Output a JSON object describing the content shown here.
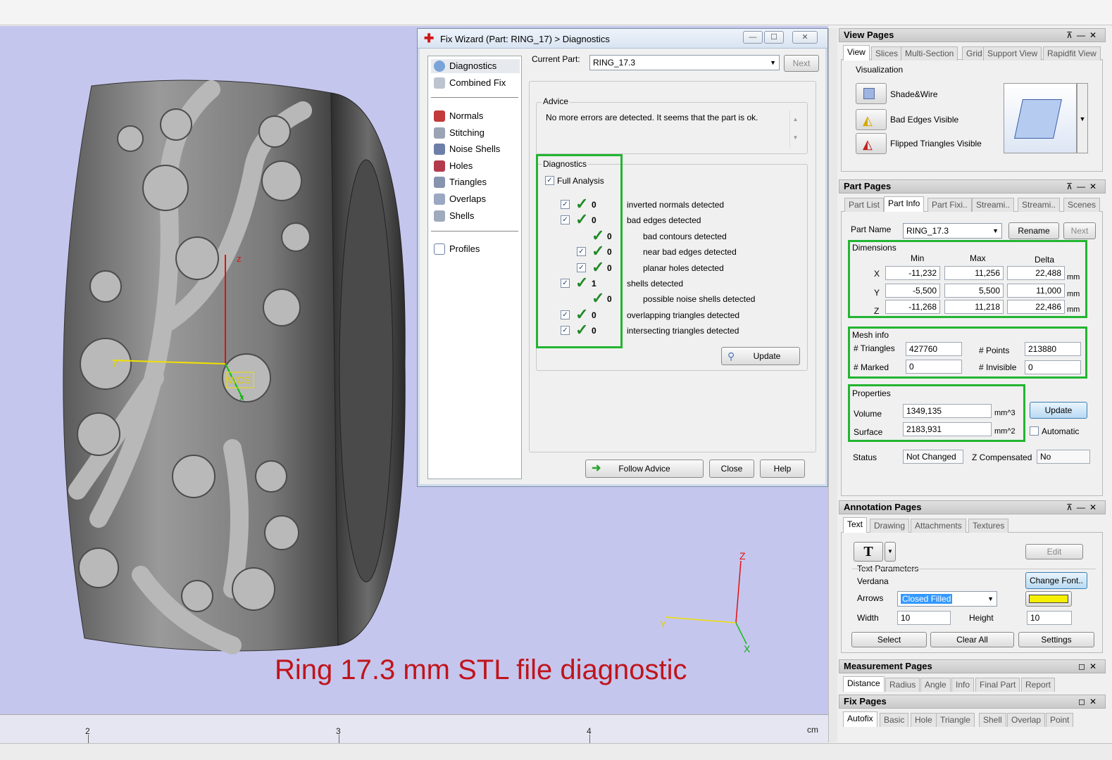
{
  "viewport": {
    "caption": "Ring 17.3 mm STL file diagnostic",
    "axes": {
      "z": "Z",
      "y": "Y",
      "x": "X",
      "wcs": "WCS",
      "small_z": "z",
      "small_y": "y",
      "small_x": "x"
    },
    "ruler": {
      "ticks": [
        "2",
        "3",
        "4"
      ],
      "unit": "cm"
    }
  },
  "fix_wizard": {
    "title": "Fix Wizard (Part: RING_17) > Diagnostics",
    "nav": {
      "top": [
        "Diagnostics",
        "Combined Fix"
      ],
      "middle": [
        "Normals",
        "Stitching",
        "Noise Shells",
        "Holes",
        "Triangles",
        "Overlaps",
        "Shells"
      ],
      "bottom": [
        "Profiles"
      ]
    },
    "current_part_label": "Current Part:",
    "current_part_value": "RING_17.3",
    "next_label": "Next",
    "advice_label": "Advice",
    "advice_text": "No more errors are detected. It seems that the part is ok.",
    "diagnostics_label": "Diagnostics",
    "full_analysis_label": "Full Analysis",
    "rows": [
      {
        "count": "0",
        "text": "inverted normals detected",
        "checkbox": true
      },
      {
        "count": "0",
        "text": "bad edges detected",
        "checkbox": true
      },
      {
        "count": "0",
        "text": "bad contours detected",
        "checkbox": false
      },
      {
        "count": "0",
        "text": "near bad edges detected",
        "checkbox": true
      },
      {
        "count": "0",
        "text": "planar holes detected",
        "checkbox": true
      },
      {
        "count": "1",
        "text": "shells detected",
        "checkbox": true
      },
      {
        "count": "0",
        "text": "possible noise shells detected",
        "checkbox": false
      },
      {
        "count": "0",
        "text": "overlapping triangles detected",
        "checkbox": true
      },
      {
        "count": "0",
        "text": "intersecting triangles detected",
        "checkbox": true
      }
    ],
    "update_label": "Update",
    "follow_advice_label": "Follow Advice",
    "close_label": "Close",
    "help_label": "Help"
  },
  "view_pages": {
    "title": "View Pages",
    "tabs": [
      "View",
      "Slices",
      "Multi-Section",
      "Grid",
      "Support View",
      "Rapidfit View"
    ],
    "visualization_label": "Visualization",
    "options": [
      "Shade&Wire",
      "Bad Edges Visible",
      "Flipped Triangles Visible"
    ]
  },
  "part_pages": {
    "title": "Part Pages",
    "tabs": [
      "Part List",
      "Part Info",
      "Part Fixi..",
      "Streami..",
      "Streami..",
      "Scenes"
    ],
    "part_name_label": "Part Name",
    "part_name_value": "RING_17.3",
    "rename_label": "Rename",
    "next_label": "Next",
    "dimensions_label": "Dimensions",
    "dim_headers": [
      "Min",
      "Max",
      "Delta"
    ],
    "dims": [
      {
        "axis": "X",
        "min": "-11,232",
        "max": "11,256",
        "delta": "22,488",
        "unit": "mm"
      },
      {
        "axis": "Y",
        "min": "-5,500",
        "max": "5,500",
        "delta": "11,000",
        "unit": "mm"
      },
      {
        "axis": "Z",
        "min": "-11,268",
        "max": "11,218",
        "delta": "22,486",
        "unit": "mm"
      }
    ],
    "mesh_info_label": "Mesh info",
    "triangles_label": "# Triangles",
    "triangles_value": "427760",
    "points_label": "# Points",
    "points_value": "213880",
    "marked_label": "# Marked",
    "marked_value": "0",
    "invisible_label": "# Invisible",
    "invisible_value": "0",
    "properties_label": "Properties",
    "volume_label": "Volume",
    "volume_value": "1349,135",
    "volume_unit": "mm^3",
    "surface_label": "Surface",
    "surface_value": "2183,931",
    "surface_unit": "mm^2",
    "update_label": "Update",
    "automatic_label": "Automatic",
    "status_label": "Status",
    "status_value": "Not Changed",
    "zcomp_label": "Z Compensated",
    "zcomp_value": "No"
  },
  "annotation_pages": {
    "title": "Annotation Pages",
    "tabs": [
      "Text",
      "Drawing",
      "Attachments",
      "Textures"
    ],
    "text_tool": "T",
    "edit_label": "Edit",
    "text_params_label": "Text Parameters",
    "font_name": "Verdana",
    "change_font_label": "Change Font..",
    "arrows_label": "Arrows",
    "arrows_value": "Closed Filled",
    "width_label": "Width",
    "width_value": "10",
    "height_label": "Height",
    "height_value": "10",
    "select_label": "Select",
    "clear_all_label": "Clear All",
    "settings_label": "Settings",
    "color": "#f5ef00"
  },
  "measurement_pages": {
    "title": "Measurement Pages",
    "tabs": [
      "Distance",
      "Radius",
      "Angle",
      "Info",
      "Final Part",
      "Report"
    ]
  },
  "fix_pages": {
    "title": "Fix Pages",
    "tabs": [
      "Autofix",
      "Basic",
      "Hole",
      "Triangle",
      "Shell",
      "Overlap",
      "Point"
    ]
  },
  "colors": {
    "highlight_green": "#22b531",
    "caption_red": "#c0141c",
    "viewport_bg": "#c5c6ed"
  }
}
